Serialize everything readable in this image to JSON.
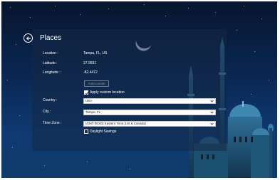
{
  "header": {
    "title": "Places",
    "back_icon": "back-arrow-icon"
  },
  "info": {
    "location_label": "Location :",
    "location_value": "Tampa, FL, US",
    "latitude_label": "Latitude :",
    "latitude_value": "27.9591",
    "longitude_label": "Longitude :",
    "longitude_value": "-82.4472"
  },
  "auto_locate": {
    "label": "Auto Locate"
  },
  "custom_location": {
    "label": "Apply custom location",
    "checked": true
  },
  "country": {
    "label": "Country :",
    "value": "USA"
  },
  "city": {
    "label": "City :",
    "value": "Tampa, FL"
  },
  "timezone": {
    "label": "Time Zone :",
    "value": "(GMT-05:00) Eastern Time (US & Canada)"
  },
  "daylight": {
    "label": "Daylight Savings",
    "checked": false
  },
  "colors": {
    "sky_top": "#07162e",
    "sky_bottom": "#0f3a72",
    "text": "#ffffff"
  }
}
